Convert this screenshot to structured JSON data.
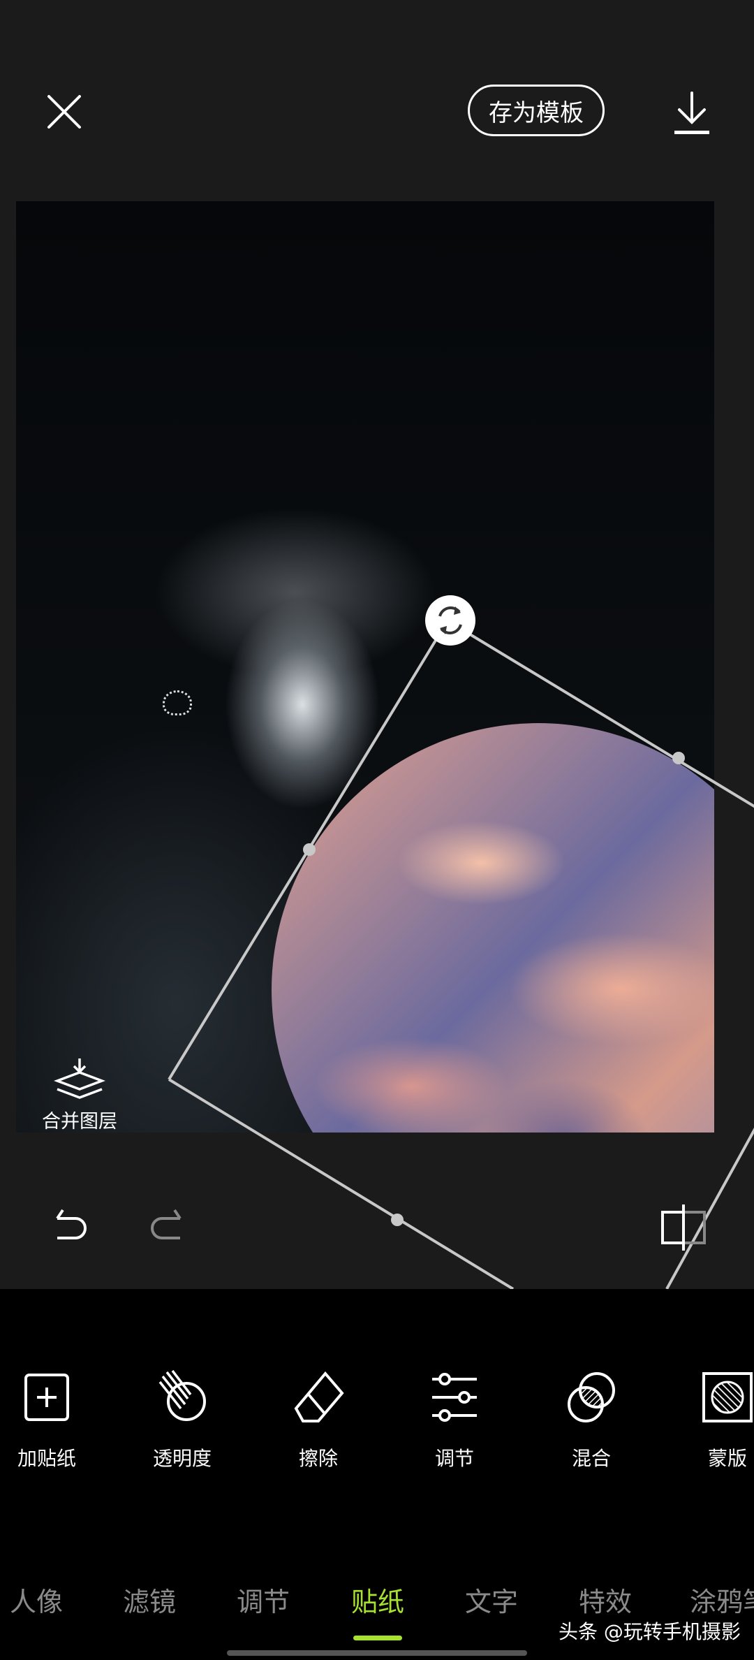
{
  "header": {
    "close_icon": "close-icon",
    "save_template_label": "存为模板",
    "download_icon": "download-icon"
  },
  "canvas": {
    "merge_layers_label": "合并图层",
    "merge_layers_icon": "merge-layers-icon",
    "sticker_rotate_icon": "rotate-icon"
  },
  "edit_bar": {
    "undo_icon": "undo-icon",
    "redo_icon": "redo-icon",
    "compare_icon": "compare-icon"
  },
  "tools": [
    {
      "label": "加贴纸",
      "icon": "add-sticker-icon"
    },
    {
      "label": "透明度",
      "icon": "opacity-icon"
    },
    {
      "label": "擦除",
      "icon": "eraser-icon"
    },
    {
      "label": "调节",
      "icon": "sliders-icon"
    },
    {
      "label": "混合",
      "icon": "blend-icon"
    },
    {
      "label": "蒙版",
      "icon": "mask-icon"
    }
  ],
  "tabs": [
    {
      "label": "人像"
    },
    {
      "label": "滤镜"
    },
    {
      "label": "调节"
    },
    {
      "label": "贴纸",
      "active": true
    },
    {
      "label": "文字"
    },
    {
      "label": "特效"
    },
    {
      "label": "涂鸦笔"
    }
  ],
  "watermark": "头条 @玩转手机摄影",
  "colors": {
    "accent": "#a6e22e",
    "background": "#1b1b1b",
    "toolbar": "#000000"
  }
}
